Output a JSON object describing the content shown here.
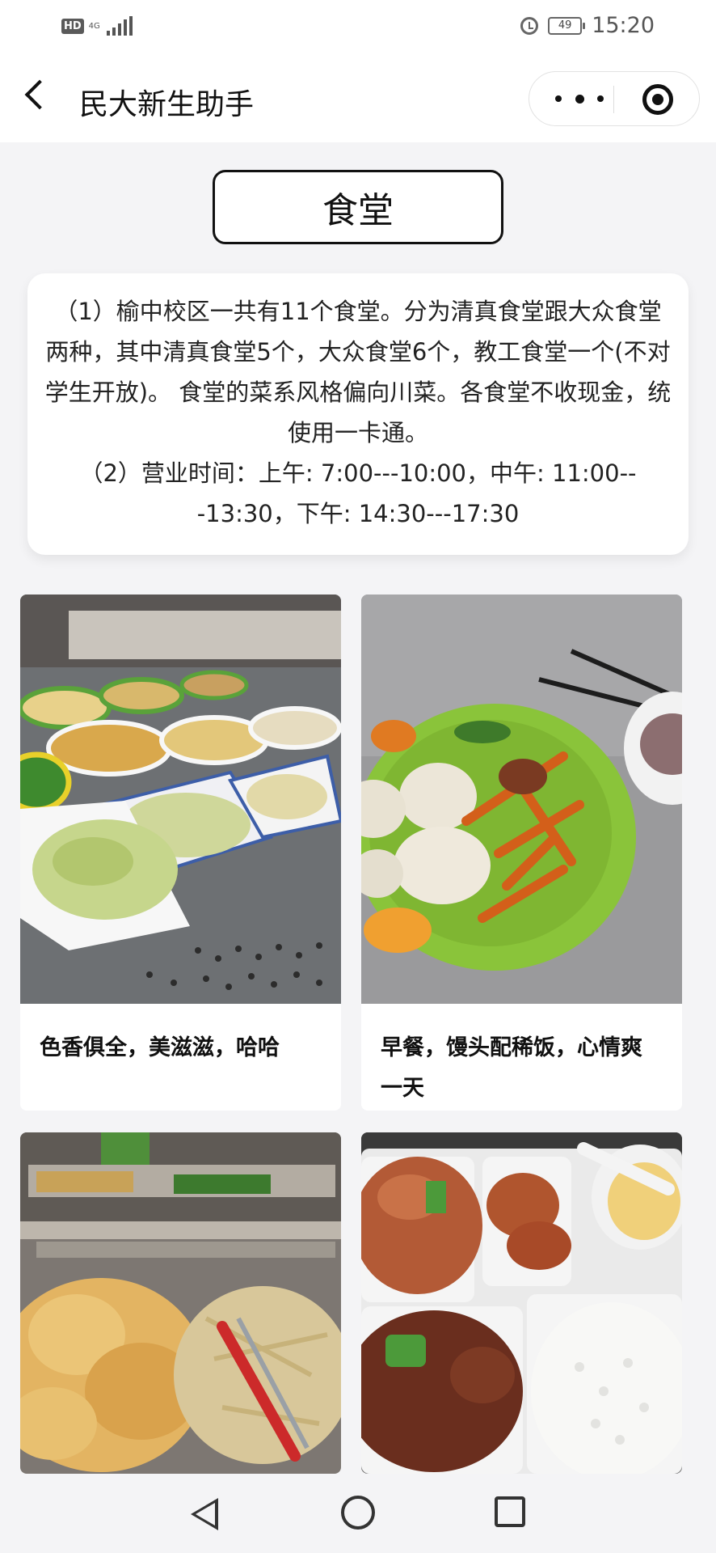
{
  "status_bar": {
    "hd_label": "HD",
    "network_label": "4G",
    "battery_level": "49",
    "time": "15:20",
    "icons": [
      "signal-icon",
      "alarm-icon",
      "battery-icon"
    ]
  },
  "header": {
    "title": "民大新生助手",
    "icons": [
      "back-icon",
      "more-icon",
      "close-miniprogram-icon"
    ]
  },
  "section": {
    "title": "食堂"
  },
  "info": {
    "paragraph1": "（1）榆中校区一共有11个食堂。分为清真食堂跟大众食堂两种，其中清真食堂5个，大众食堂6个，教工食堂一个(不对学生开放)。 食堂的菜系风格偏向川菜。各食堂不收现金，统使用一卡通。",
    "paragraph2": "（2）营业时间：上午: 7:00---10:00，中午: 11:00---13:30，下午: 14:30---17:30"
  },
  "food_cards": [
    {
      "caption": "色香俱全，美滋滋，哈哈"
    },
    {
      "caption": "早餐，馒头配稀饭，心情爽一天"
    },
    {
      "caption": ""
    },
    {
      "caption": ""
    }
  ],
  "nav_bar": {
    "icons": [
      "nav-back-icon",
      "nav-home-icon",
      "nav-recent-icon"
    ]
  },
  "colors": {
    "background": "#f4f4f6",
    "card": "#ffffff",
    "text": "#111111"
  }
}
